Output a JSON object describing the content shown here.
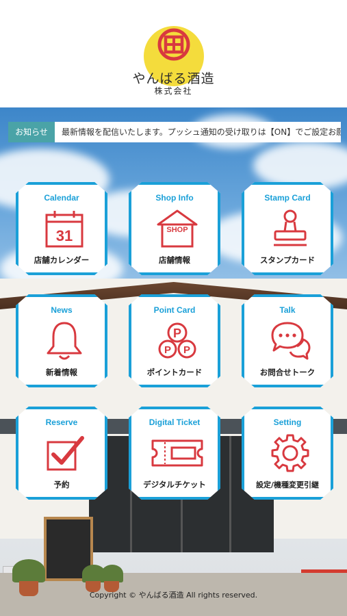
{
  "header": {
    "logo_char": "田",
    "brand_name": "やんばる酒造",
    "brand_sub": "株式会社"
  },
  "news": {
    "tag": "お知らせ",
    "text": "最新情報を配信いたします。プッシュ通知の受け取りは【ON】でご設定お願いします。"
  },
  "tiles": [
    {
      "title": "Calendar",
      "label": "店舗カレンダー",
      "icon": "calendar-icon",
      "icon_text": "31"
    },
    {
      "title": "Shop Info",
      "label": "店舗情報",
      "icon": "shop-icon",
      "icon_text": "SHOP"
    },
    {
      "title": "Stamp Card",
      "label": "スタンプカード",
      "icon": "stamp-icon"
    },
    {
      "title": "News",
      "label": "新着情報",
      "icon": "bell-icon"
    },
    {
      "title": "Point Card",
      "label": "ポイントカード",
      "icon": "points-icon",
      "icon_text": "P"
    },
    {
      "title": "Talk",
      "label": "お問合せトーク",
      "icon": "chat-icon"
    },
    {
      "title": "Reserve",
      "label": "予約",
      "icon": "checkbox-icon"
    },
    {
      "title": "Digital Ticket",
      "label": "デジタルチケット",
      "icon": "ticket-icon"
    },
    {
      "title": "Setting",
      "label": "設定/機種変更引継",
      "icon": "gear-icon"
    }
  ],
  "footer": {
    "copyright": "Copyright © やんばる酒造 All rights reserved."
  },
  "colors": {
    "accent": "#1aa0d8",
    "icon_red": "#d8393f",
    "news_tag": "#4aa3a7",
    "logo_yellow": "#f4dc3c"
  }
}
